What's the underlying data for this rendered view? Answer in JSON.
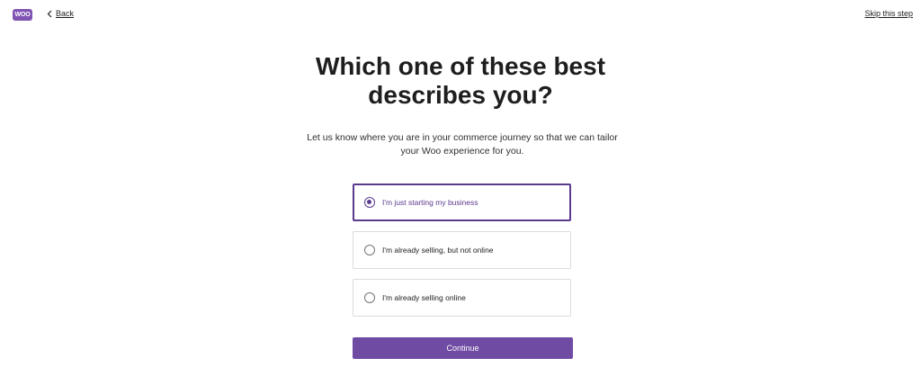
{
  "header": {
    "logo_text": "WOO",
    "back_label": "Back",
    "skip_label": "Skip this step"
  },
  "main": {
    "title_line1": "Which one of these best",
    "title_line2": "describes you?",
    "subtitle": "Let us know where you are in your commerce journey so that we can tailor your Woo experience for you."
  },
  "options": [
    {
      "label": "I'm just starting my business",
      "selected": true
    },
    {
      "label": "I'm already selling, but not online",
      "selected": false
    },
    {
      "label": "I'm already selling online",
      "selected": false
    }
  ],
  "continue_label": "Continue",
  "colors": {
    "accent": "#6f4ba3",
    "selected_border": "#5b3a8e",
    "logo": "#7f54b3"
  }
}
